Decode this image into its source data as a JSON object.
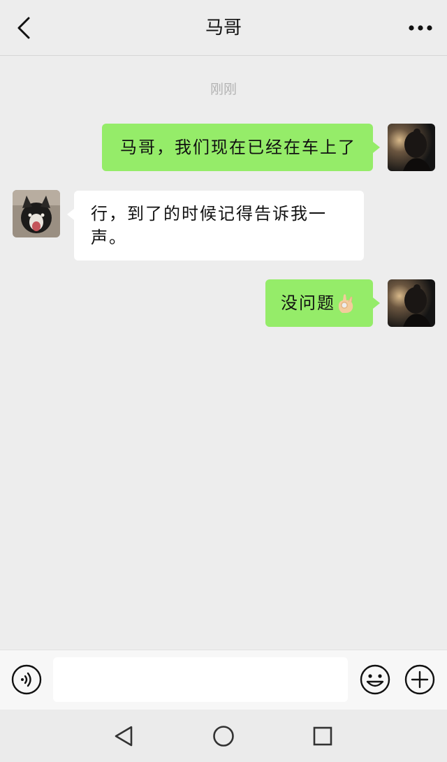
{
  "header": {
    "title": "马哥",
    "back_icon": "chevron-left-icon",
    "more_icon": "more-dots-icon"
  },
  "chat": {
    "timestamp": "刚刚",
    "messages": [
      {
        "side": "out",
        "text": "马哥，我们现在已经在车上了"
      },
      {
        "side": "in",
        "text": "行，到了的时候记得告诉我一声。"
      },
      {
        "side": "out",
        "text": "没问题",
        "emoji": "ok-hand-emoji"
      }
    ]
  },
  "input_bar": {
    "voice_icon": "voice-icon",
    "text_value": "",
    "emoji_icon": "smiley-icon",
    "plus_icon": "plus-icon"
  },
  "navbar": {
    "back_icon": "triangle-back-icon",
    "home_icon": "circle-home-icon",
    "recent_icon": "square-recent-icon"
  },
  "colors": {
    "bubble_out": "#95ec69",
    "bubble_in": "#ffffff",
    "background": "#ededed"
  }
}
